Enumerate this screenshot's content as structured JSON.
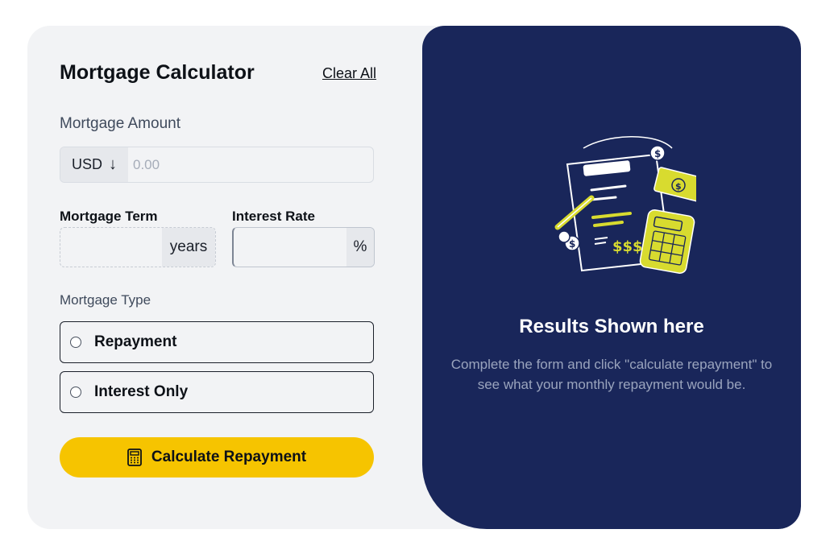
{
  "header": {
    "title": "Mortgage Calculator",
    "clear_label": "Clear All"
  },
  "form": {
    "amount": {
      "label": "Mortgage Amount",
      "currency": "USD",
      "currency_arrow": "↓",
      "placeholder": "0.00",
      "value": ""
    },
    "term": {
      "label": "Mortgage Term",
      "suffix": "years",
      "value": ""
    },
    "rate": {
      "label": "Interest Rate",
      "suffix": "%",
      "value": ""
    },
    "type": {
      "label": "Mortgage Type",
      "options": [
        {
          "label": "Repayment",
          "selected": false
        },
        {
          "label": "Interest Only",
          "selected": false
        }
      ]
    },
    "submit_label": "Calculate Repayment"
  },
  "results": {
    "title": "Results Shown here",
    "description": "Complete the form and click \"calculate repayment\" to see what your monthly repayment would be."
  },
  "colors": {
    "panel_bg": "#f2f3f5",
    "results_bg": "#19265a",
    "accent": "#f6c400",
    "illustration_accent": "#d8db2f"
  },
  "icons": {
    "button_icon": "calculator-icon",
    "illustration": "empty-results-illustration"
  }
}
